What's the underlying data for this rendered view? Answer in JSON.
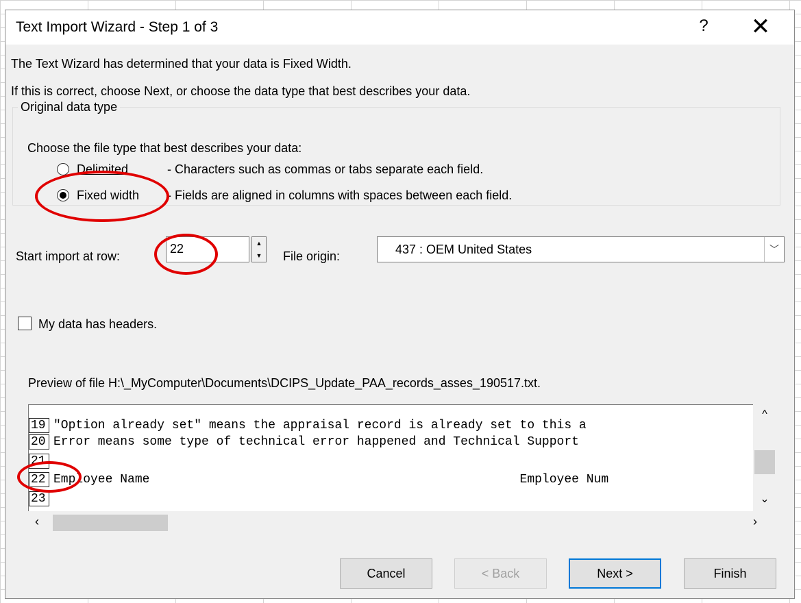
{
  "window": {
    "title": "Text Import Wizard - Step 1 of 3",
    "help_label": "?",
    "close_label": "✕"
  },
  "intro": {
    "line1": "The Text Wizard has determined that your data is Fixed Width.",
    "line2": "If this is correct, choose Next, or choose the data type that best describes your data."
  },
  "original_data_type": {
    "legend": "Original data type",
    "prompt": "Choose the file type that best describes your data:",
    "options": [
      {
        "label": "Delimited",
        "description": "- Characters such as commas or tabs separate each field.",
        "selected": false
      },
      {
        "label": "Fixed width",
        "description": "- Fields are aligned in columns with spaces between each field.",
        "selected": true
      }
    ]
  },
  "start_row": {
    "label": "Start import at row:",
    "value": "22"
  },
  "file_origin": {
    "label": "File origin:",
    "value": "437 : OEM United States"
  },
  "headers_checkbox": {
    "label": "My data has headers.",
    "checked": false
  },
  "preview": {
    "caption": "Preview of file H:\\_MyComputer\\Documents\\DCIPS_Update_PAA_records_asses_190517.txt.",
    "rows": [
      {
        "num": "19",
        "text": "\"Option already set\" means the appraisal record is already set to this a"
      },
      {
        "num": "20",
        "text": "Error means some type of technical error happened and Technical Support"
      },
      {
        "num": "21",
        "text": ""
      },
      {
        "num": "22",
        "text": "Employee Name                                                  Employee Num"
      },
      {
        "num": "23",
        "text": ""
      }
    ]
  },
  "buttons": {
    "cancel": "Cancel",
    "back": "< Back",
    "next": "Next >",
    "finish": "Finish"
  },
  "colors": {
    "annotation_circle": "#e00000",
    "default_button_border": "#0078d7",
    "dialog_background": "#f0f0f0"
  }
}
